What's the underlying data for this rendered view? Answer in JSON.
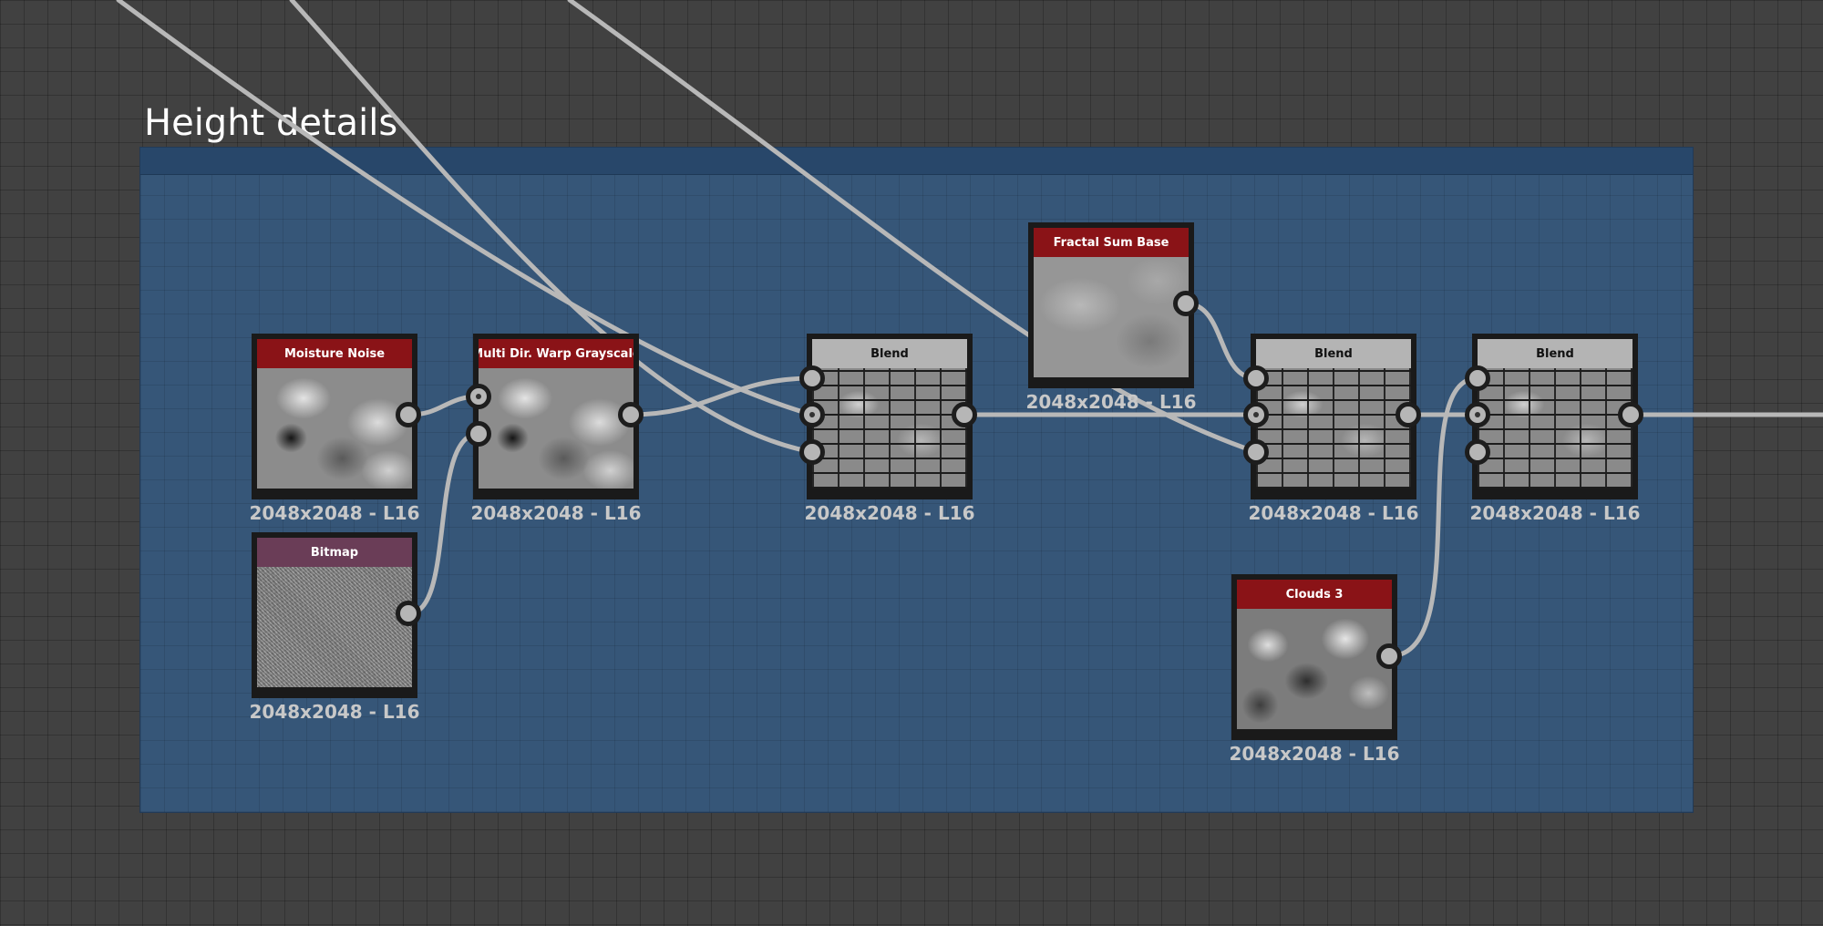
{
  "frame": {
    "title": "Height details"
  },
  "nodes": {
    "moisture_noise": {
      "label": "Moisture Noise",
      "resolution": "2048x2048 - L16"
    },
    "bitmap": {
      "label": "Bitmap",
      "resolution": "2048x2048 - L16"
    },
    "multi_dir_warp": {
      "label": "Multi Dir. Warp Grayscale",
      "resolution": "2048x2048 - L16"
    },
    "blend_1": {
      "label": "Blend",
      "resolution": "2048x2048 - L16"
    },
    "fractal_sum_base": {
      "label": "Fractal Sum Base",
      "resolution": "2048x2048 - L16"
    },
    "blend_2": {
      "label": "Blend",
      "resolution": "2048x2048 - L16"
    },
    "blend_3": {
      "label": "Blend",
      "resolution": "2048x2048 - L16"
    },
    "clouds_3": {
      "label": "Clouds 3",
      "resolution": "2048x2048 - L16"
    }
  },
  "colors": {
    "canvas_bg": "#414141",
    "frame_bg": "#365678",
    "generator_header": "#8a1317",
    "filter_header": "#b4b4b4",
    "bitmap_header": "#6a3d57",
    "wire": "#b8b8b8"
  }
}
